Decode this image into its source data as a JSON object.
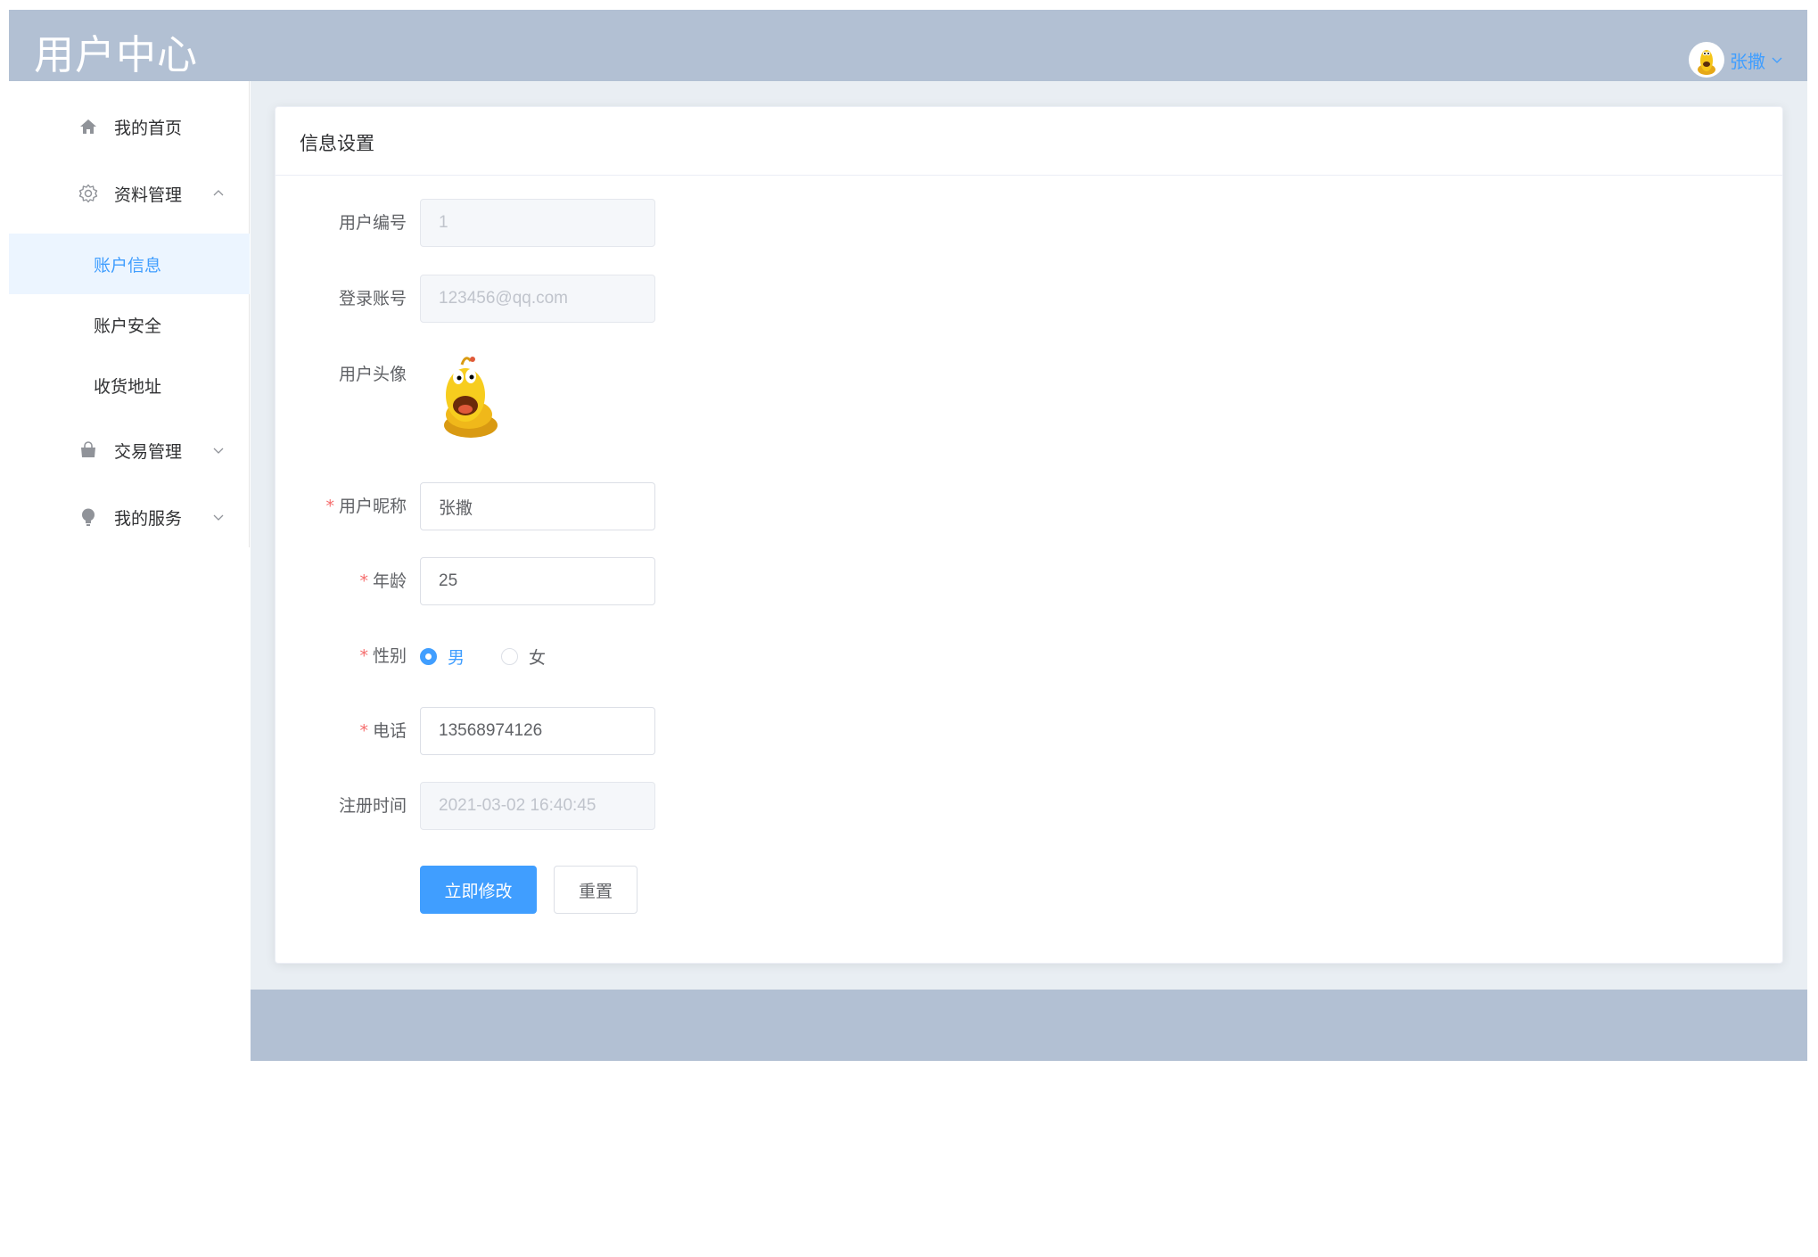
{
  "header": {
    "title": "用户中心",
    "user_name": "张撒",
    "avatar_icon": "larva-avatar-icon",
    "bg_color": "#b2c0d3"
  },
  "sidebar": {
    "items": [
      {
        "label": "我的首页",
        "icon": "home-icon"
      },
      {
        "label": "资料管理",
        "icon": "gear-icon",
        "expanded": true,
        "children": [
          {
            "label": "账户信息",
            "active": true
          },
          {
            "label": "账户安全"
          },
          {
            "label": "收货地址"
          }
        ]
      },
      {
        "label": "交易管理",
        "icon": "shopping-bag-icon",
        "expanded": false
      },
      {
        "label": "我的服务",
        "icon": "lightbulb-icon",
        "expanded": false
      }
    ]
  },
  "card": {
    "title": "信息设置"
  },
  "form": {
    "user_id": {
      "label": "用户编号",
      "value": "1",
      "disabled": true
    },
    "login_account": {
      "label": "登录账号",
      "value": "123456@qq.com",
      "disabled": true
    },
    "avatar": {
      "label": "用户头像"
    },
    "nickname": {
      "label": "用户昵称",
      "value": "张撒",
      "required": true
    },
    "age": {
      "label": "年龄",
      "value": "25",
      "required": true
    },
    "gender": {
      "label": "性别",
      "required": true,
      "options": [
        "男",
        "女"
      ],
      "selected": "男"
    },
    "phone": {
      "label": "电话",
      "value": "13568974126",
      "required": true
    },
    "register_time": {
      "label": "注册时间",
      "value": "2021-03-02 16:40:45",
      "disabled": true
    },
    "submit_label": "立即修改",
    "reset_label": "重置"
  },
  "colors": {
    "accent": "#409eff",
    "required": "#f56c6c",
    "main_bg": "#e9eef3"
  }
}
